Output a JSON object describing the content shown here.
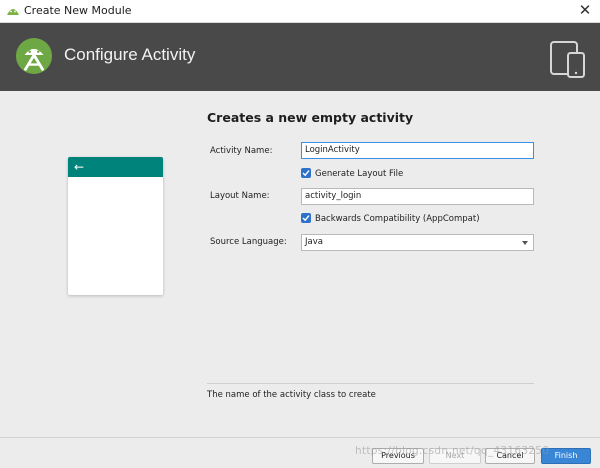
{
  "window": {
    "title": "Create New Module",
    "close_glyph": "✕"
  },
  "header": {
    "title": "Configure Activity",
    "logo_icon": "android-studio-icon",
    "device_icon": "devices-icon"
  },
  "preview": {
    "back_glyph": "←",
    "appbar_color": "#00837a"
  },
  "form": {
    "heading": "Creates a new empty activity",
    "activity_name_label": "Activity Name:",
    "activity_name_value": "LoginActivity",
    "generate_layout_label": "Generate Layout File",
    "generate_layout_checked": true,
    "layout_name_label": "Layout Name:",
    "layout_name_value": "activity_login",
    "backwards_compat_label": "Backwards Compatibility (AppCompat)",
    "backwards_compat_checked": true,
    "source_language_label": "Source Language:",
    "source_language_value": "Java"
  },
  "help_text": "The name of the activity class to create",
  "footer": {
    "previous_label": "Previous",
    "next_label": "Next",
    "cancel_label": "Cancel",
    "finish_label": "Finish"
  },
  "watermark": "https://blog.csdn.net/qq_43163250",
  "colors": {
    "header_bg": "#494949",
    "accent": "#3a86d6",
    "teal": "#00837a"
  }
}
